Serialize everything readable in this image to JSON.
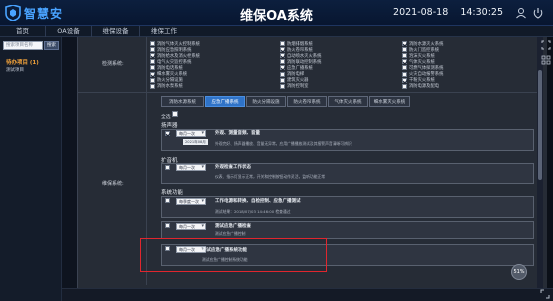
{
  "header": {
    "logo_text": "智慧安",
    "title": "维保OA系统",
    "datetime": "2021-08-18    14:30:25"
  },
  "nav": {
    "items": [
      {
        "label": "首页"
      },
      {
        "label": "OA设备"
      },
      {
        "label": "维保设备"
      },
      {
        "label": "维保工作"
      }
    ]
  },
  "sidebar": {
    "search_placeholder": "搜索项目名称",
    "search_button": "搜索",
    "section_label": "待办项目 (1)",
    "item_label": "测试项目"
  },
  "form": {
    "row1_label": "检测系统:",
    "row2_label": "维保系统:",
    "checkboxes": [
      {
        "label": "消防气体灭火控制系统",
        "checked": false
      },
      {
        "label": "防烟排烟系统",
        "checked": false
      },
      {
        "label": "消防水源灭火系统",
        "checked": true
      },
      {
        "label": "消防应急照明系统",
        "checked": false
      },
      {
        "label": "防火卷帘系统",
        "checked": true
      },
      {
        "label": "防火门监控系统",
        "checked": false
      },
      {
        "label": "消防给水及消火栓系统",
        "checked": true
      },
      {
        "label": "自动喷水灭火系统",
        "checked": true
      },
      {
        "label": "泡沫灭火系统",
        "checked": false
      },
      {
        "label": "电气火灾监控系统",
        "checked": false
      },
      {
        "label": "消防联动控制系统",
        "checked": false
      },
      {
        "label": "气体灭火系统",
        "checked": true
      },
      {
        "label": "消防电话系统",
        "checked": false
      },
      {
        "label": "应急广播系统",
        "checked": true
      },
      {
        "label": "可燃气体探测系统",
        "checked": false
      },
      {
        "label": "细水雾灭火系统",
        "checked": true
      },
      {
        "label": "消防电梯",
        "checked": false
      },
      {
        "label": "火灾自动报警系统",
        "checked": false
      },
      {
        "label": "防火分隔设施",
        "checked": false
      },
      {
        "label": "建筑灭火器",
        "checked": false
      },
      {
        "label": "干粉灭火系统",
        "checked": true
      },
      {
        "label": "消防水泵系统",
        "checked": false
      },
      {
        "label": "消防控制室",
        "checked": false
      },
      {
        "label": "消防电源及配电",
        "checked": false
      }
    ],
    "tabs": [
      {
        "label": "消防水源系统"
      },
      {
        "label": "应急广播系统"
      },
      {
        "label": "防火分隔设施"
      },
      {
        "label": "防火卷帘系统"
      },
      {
        "label": "气体灭火系统"
      },
      {
        "label": "细水雾灭火系统"
      }
    ],
    "select_all_label": "全选",
    "sections": [
      {
        "title": "扬声器"
      },
      {
        "title": "扩音机"
      },
      {
        "title": "系统功能"
      }
    ],
    "cards": [
      {
        "select": "每月一次",
        "title": "外观、测量音频、音量",
        "sub": "外观完好、扬声器播放、音量无异常，应用广播播放测试及其报警声音清晰可辨识",
        "tag": ""
      },
      {
        "select": "每月一次",
        "title": "外观检查工作状态",
        "sub": "仪表、指示灯显示正常，开关和控制按钮动作灵活，监听功能正常",
        "tag": ""
      },
      {
        "select": "每季度一次",
        "title": "工作电源和转换、自检控制、应急广播测试",
        "sub": "测试结果：2018/07/03 14:46:00 检查通过",
        "tag": ""
      },
      {
        "select": "每月一次",
        "title": "测试应急广播检查",
        "sub": "测试应急广播控制",
        "tag": ""
      },
      {
        "select": "每月一次",
        "title": "测试应急广播系统功能",
        "sub": "测试应急广播控制系统功能",
        "tag": ""
      }
    ],
    "date_tag": "2021年08月",
    "zoom": "51%"
  }
}
